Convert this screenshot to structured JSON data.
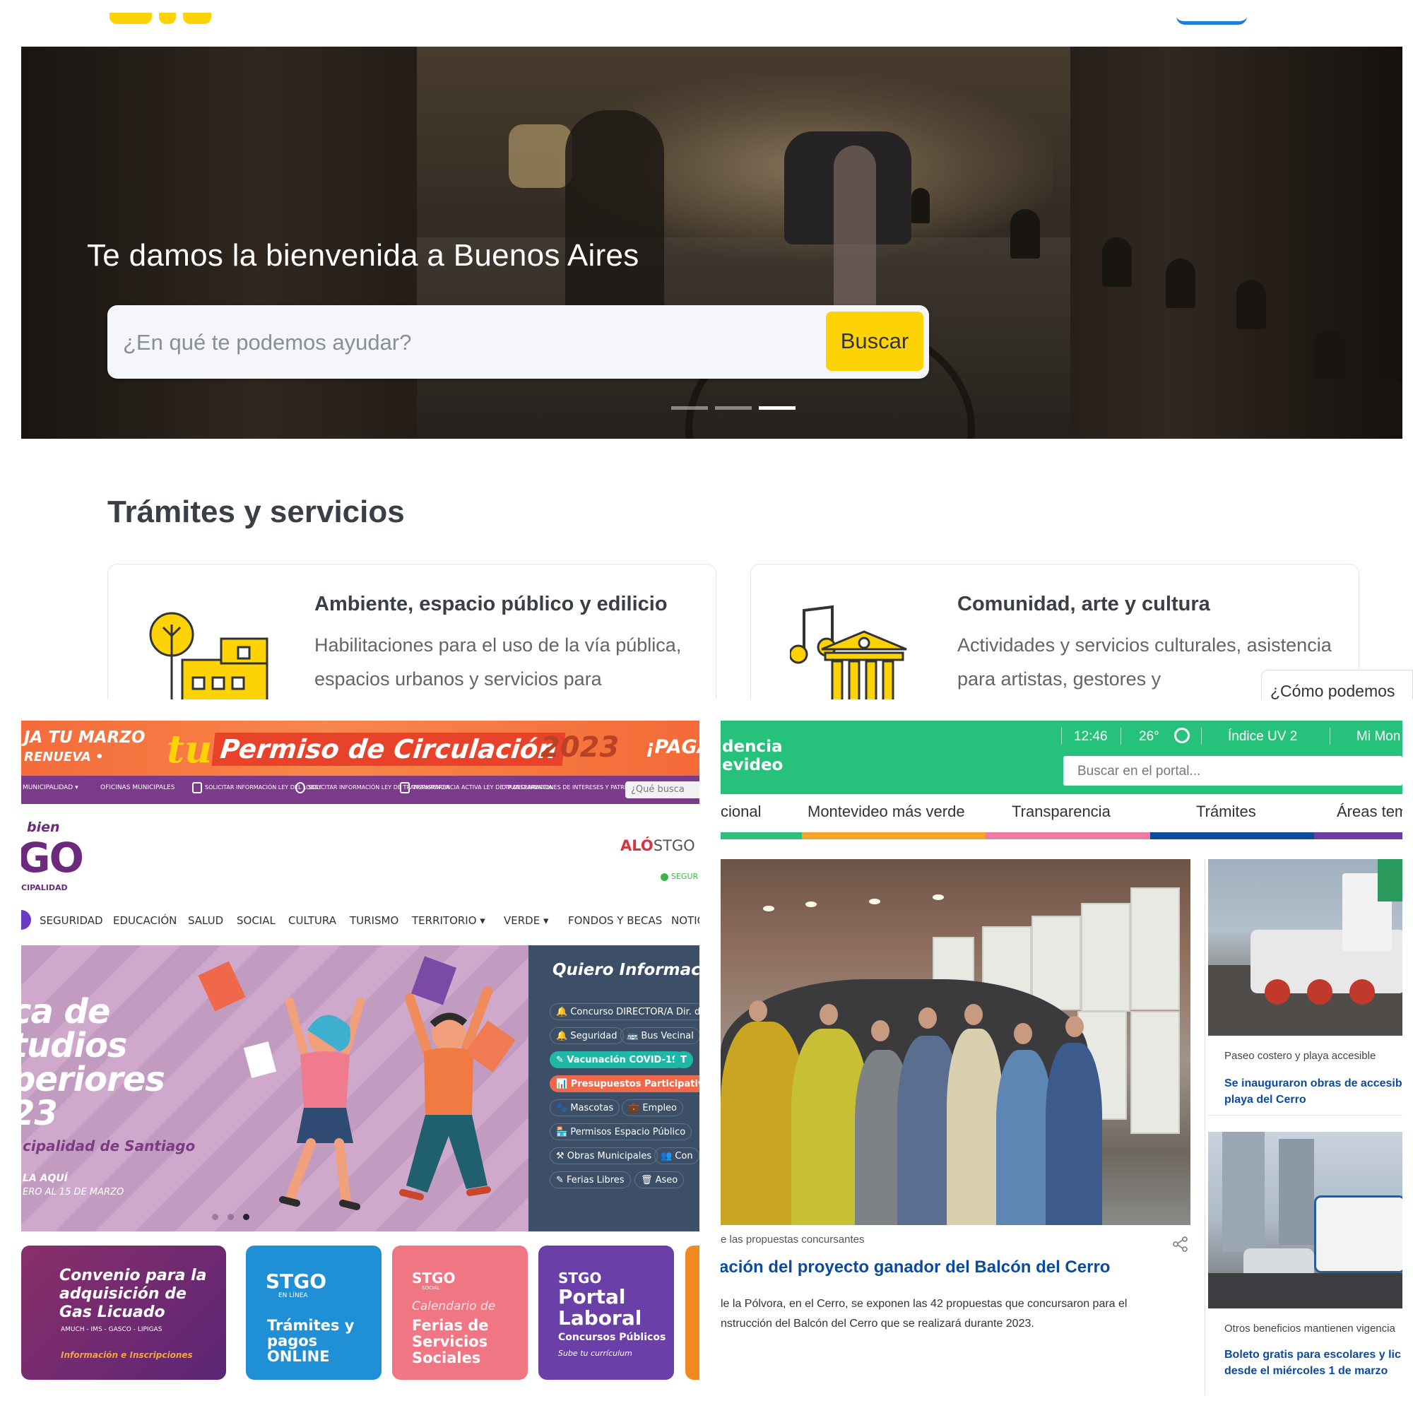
{
  "buenos_aires": {
    "hero_title": "Te damos la bienvenida a Buenos Aires",
    "search_placeholder": "¿En qué te podemos ayudar?",
    "search_button": "Buscar",
    "section_title": "Trámites y servicios",
    "cards": [
      {
        "title": "Ambiente, espacio público y edilicio",
        "description": "Habilitaciones para el uso de la vía pública, espacios urbanos y servicios para",
        "icon": "tree-building-icon"
      },
      {
        "title": "Comunidad, arte y cultura",
        "description": "Actividades y servicios culturales, asistencia para artistas, gestores y",
        "icon": "music-museum-icon"
      }
    ],
    "help_widget": "¿Cómo podemos",
    "carousel": {
      "slides": 3,
      "active": 3
    },
    "colors": {
      "accent": "#fdd306",
      "link": "#1d7fd6"
    }
  },
  "santiago": {
    "banner": {
      "left_line1": "JA TU MARZO",
      "left_line2": "RENUEVA •",
      "tu": "tu",
      "title": "Permiso de Circulación",
      "year": "2023",
      "right": "¡PAGA"
    },
    "topnav": [
      {
        "label": "MUNICIPALIDAD ▾"
      },
      {
        "label": "OFICINAS MUNICIPALES"
      },
      {
        "label": "SOLICITAR INFORMACIÓN LEY DEL LOBBY"
      },
      {
        "label": "SOLICITAR INFORMACIÓN LEY DE TRANSPARENCIA"
      },
      {
        "label": "TRANSPARENCIA ACTIVA LEY DE TRANSPARENCIA"
      },
      {
        "label": "DIP DECLARACIONES DE INTERESES Y PATRIMONIO"
      }
    ],
    "topnav_search": "¿Qué busca",
    "logo": {
      "line1": "bien",
      "line2": "GO",
      "line3": "CIPALIDAD"
    },
    "alo": {
      "bold": "ALÓ",
      "rest": "STGO"
    },
    "segur": "SEGUR",
    "mainnav": [
      "SEGURIDAD",
      "EDUCACIÓN",
      "SALUD",
      "SOCIAL",
      "CULTURA",
      "TURISMO",
      "TERRITORIO ▾",
      "VERDE ▾",
      "FONDOS Y BECAS",
      "NOTIC"
    ],
    "hero": {
      "title_lines": [
        "ca de",
        "tudios",
        "periores",
        "23"
      ],
      "subtitle": "cipalidad de Santiago",
      "apply": "LA AQUÍ",
      "dates": "ERO AL 15 DE MARZO"
    },
    "info": {
      "title": "Quiero Informació",
      "chips": [
        {
          "label": "🔔 Concurso DIRECTOR/A Dir. de",
          "style": "plain"
        },
        {
          "label": "🔔 Seguridad",
          "style": "plain"
        },
        {
          "label": "🚌 Bus Vecinal",
          "style": "plain"
        },
        {
          "label": "✎ Vacunación COVID-19",
          "style": "green"
        },
        {
          "label": "T",
          "style": "green"
        },
        {
          "label": "📊 Presupuestos Participativos",
          "style": "orange"
        },
        {
          "label": "🐾 Mascotas",
          "style": "plain"
        },
        {
          "label": "💼 Empleo",
          "style": "plain"
        },
        {
          "label": "🏪 Permisos Espacio Público",
          "style": "plain"
        },
        {
          "label": "⚒ Obras Municipales",
          "style": "plain"
        },
        {
          "label": "👥 Con",
          "style": "plain"
        },
        {
          "label": "✎ Ferias Libres",
          "style": "plain"
        },
        {
          "label": "🗑 Aseo",
          "style": "plain"
        }
      ]
    },
    "tiles": [
      {
        "l1": "Convenio para la",
        "l2": "adquisición de",
        "l3": "Gas Licuado",
        "small": "AMUCH - IMS - GASCO - LIPIGAS",
        "cta": "Información e Inscripciones"
      },
      {
        "brand": "STGO",
        "sub": "EN LÍNEA",
        "l1": "Trámites y",
        "l2": "pagos",
        "l3": "ONLINE"
      },
      {
        "brand": "STGO",
        "sub": "SOCIAL",
        "l0": "Calendario de",
        "l1": "Ferias de",
        "l2": "Servicios",
        "l3": "Sociales"
      },
      {
        "brand": "STGO",
        "l1": "Portal",
        "l2": "Laboral",
        "l3": "Concursos Públicos",
        "small": "Sube tu currículum"
      }
    ]
  },
  "montevideo": {
    "brand_line1": "dencia",
    "brand_line2": "evideo",
    "time": "12:46",
    "temp": "26°",
    "uv": "Índice UV 2",
    "mi": "Mi Mon",
    "search_placeholder": "Buscar en el portal...",
    "nav": [
      "cional",
      "Montevideo más verde",
      "Transparencia",
      "Trámites",
      "Áreas tem"
    ],
    "nav_colors": [
      "#2fc17c",
      "#f3a42a",
      "#ee7ba6",
      "#0a4d9b",
      "#6b3fa0"
    ],
    "main": {
      "caption": "e las propuestas concursantes",
      "headline": "ación del proyecto ganador del Balcón del Cerro",
      "body_line1": "le la Pólvora, en el Cerro, se exponen las 42 propuestas que concursaron para el",
      "body_line2": "nstrucción del Balcón del Cerro que se realizará durante 2023."
    },
    "side": [
      {
        "caption": "Paseo costero y playa accesible",
        "headline_l1": "Se inauguraron obras de accesib",
        "headline_l2": "playa del Cerro"
      },
      {
        "caption": "Otros beneficios mantienen vigencia",
        "headline_l1": "Boleto gratis para escolares y lic",
        "headline_l2": "desde el miércoles 1 de marzo"
      }
    ]
  }
}
